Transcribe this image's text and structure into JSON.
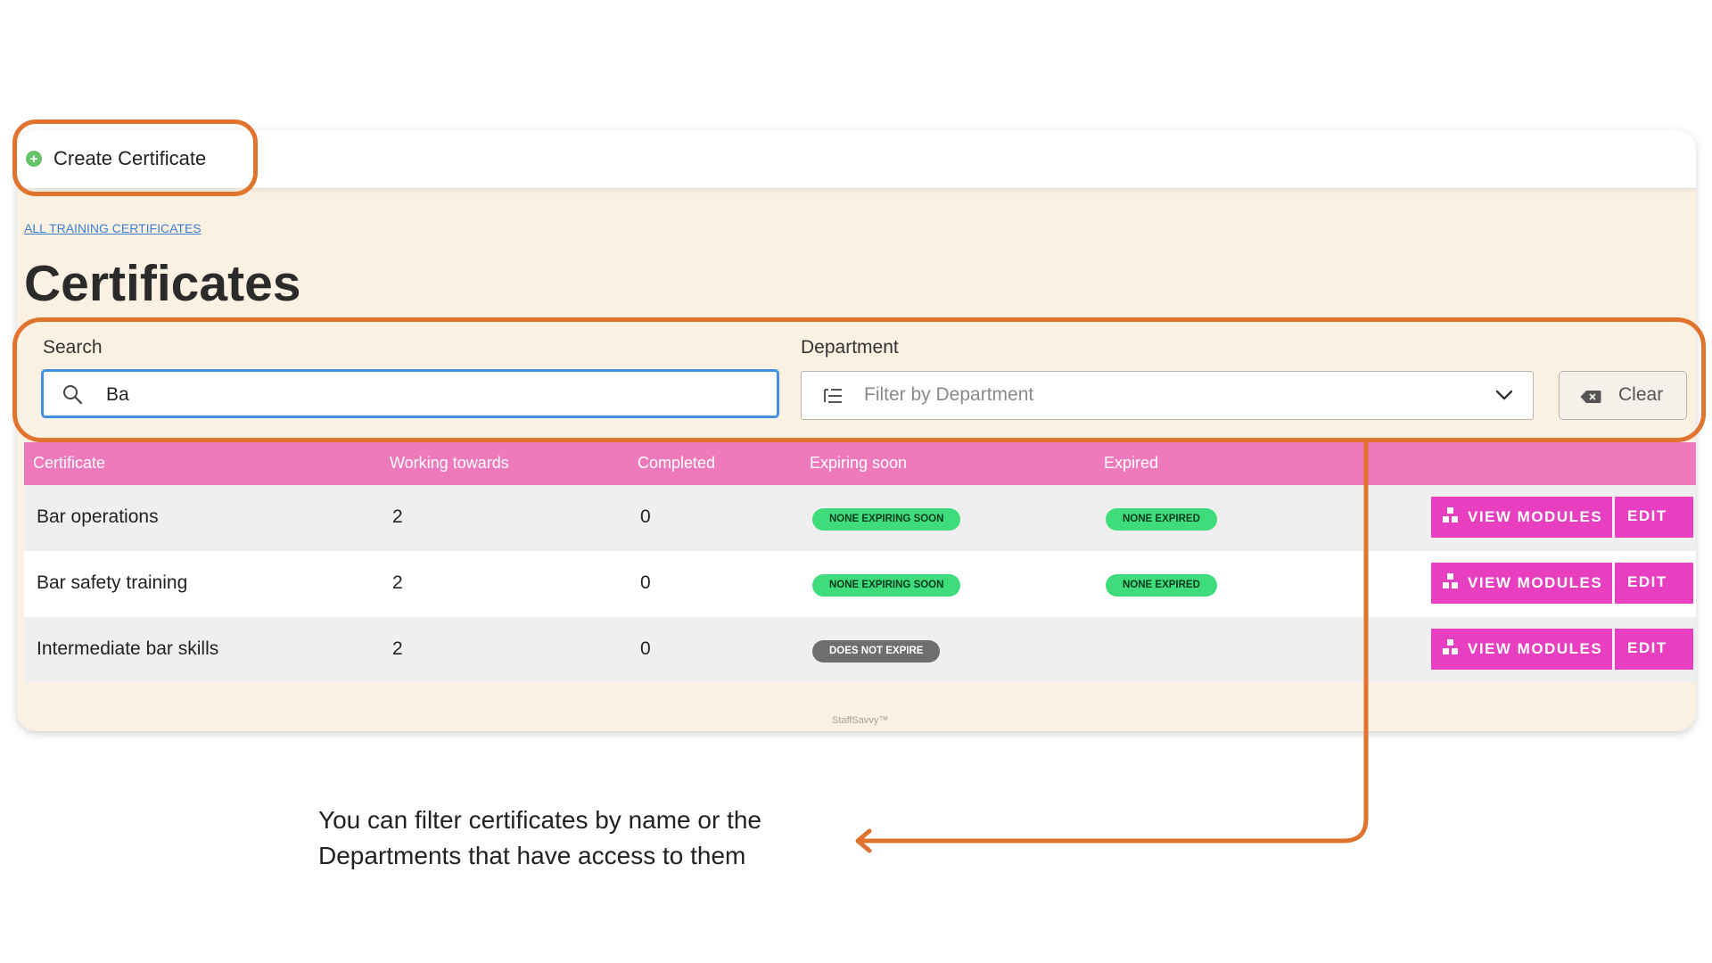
{
  "header": {
    "create_button_label": "Create Certificate"
  },
  "breadcrumb": "ALL TRAINING CERTIFICATES",
  "page_title": "Certificates",
  "filters": {
    "search_label": "Search",
    "search_value": "Ba",
    "department_label": "Department",
    "department_placeholder": "Filter by Department",
    "clear_label": "Clear"
  },
  "table": {
    "columns": [
      "Certificate",
      "Working towards",
      "Completed",
      "Expiring soon",
      "Expired"
    ],
    "rows": [
      {
        "name": "Bar operations",
        "working_towards": "2",
        "completed": "0",
        "expiring_soon": "NONE EXPIRING SOON",
        "expired": "NONE EXPIRED"
      },
      {
        "name": "Bar safety training",
        "working_towards": "2",
        "completed": "0",
        "expiring_soon": "NONE EXPIRING SOON",
        "expired": "NONE EXPIRED"
      },
      {
        "name": "Intermediate bar skills",
        "working_towards": "2",
        "completed": "0",
        "expiring_soon": "DOES NOT EXPIRE",
        "expired": ""
      }
    ],
    "view_modules_label": "VIEW MODULES",
    "edit_label": "EDIT"
  },
  "footer": "StaffSavvy™",
  "annotation": {
    "line1": "You can filter certificates by name or the",
    "line2": "Departments that have access to them"
  },
  "colors": {
    "accent_pink": "#e83fc0",
    "header_pink": "#ee7abc",
    "badge_green": "#3edc7a",
    "badge_grey": "#6e6e6e",
    "annotation_orange": "#e0742f",
    "page_bg": "#fbf1e3"
  },
  "icons": {
    "create": "plus-circle-icon",
    "search": "search-icon",
    "filter": "filter-list-icon",
    "dropdown": "chevron-down-icon",
    "clear": "backspace-icon",
    "modules": "modules-icon"
  }
}
